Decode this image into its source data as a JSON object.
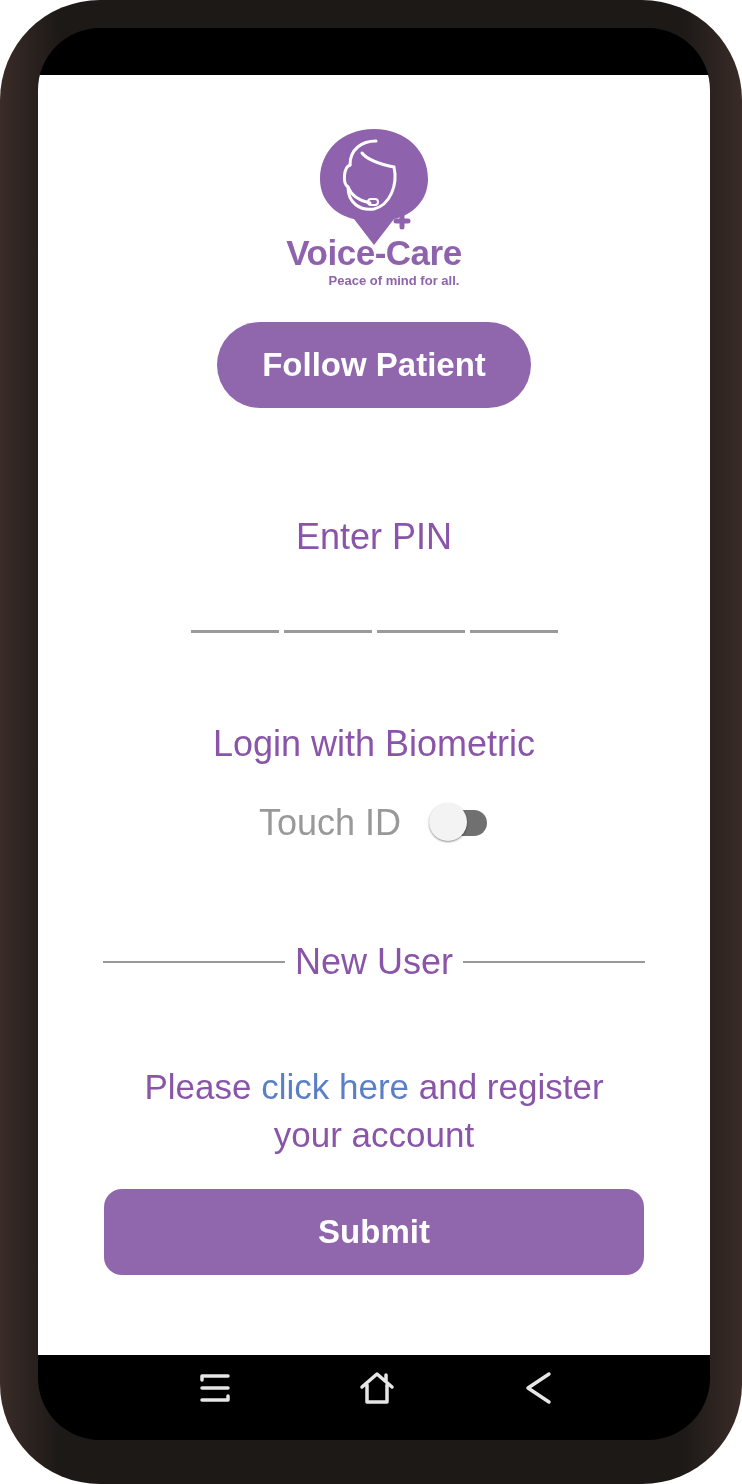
{
  "logo": {
    "name": "Voice-Care",
    "tagline": "Peace of mind for all."
  },
  "follow_button": {
    "label": "Follow Patient"
  },
  "pin": {
    "label": "Enter PIN",
    "slots": [
      {
        "filled": false
      },
      {
        "filled": false
      },
      {
        "filled": false
      },
      {
        "filled": false
      }
    ]
  },
  "biometric": {
    "title": "Login with Biometric",
    "toggle_label": "Touch ID",
    "on": false
  },
  "new_user": {
    "divider_label": "New User",
    "before": "Please ",
    "link": "click here",
    "after": " and register your account"
  },
  "submit_button": {
    "label": "Submit"
  },
  "nav_bar": [
    {
      "kind": "menu"
    },
    {
      "kind": "home"
    },
    {
      "kind": "back"
    }
  ]
}
